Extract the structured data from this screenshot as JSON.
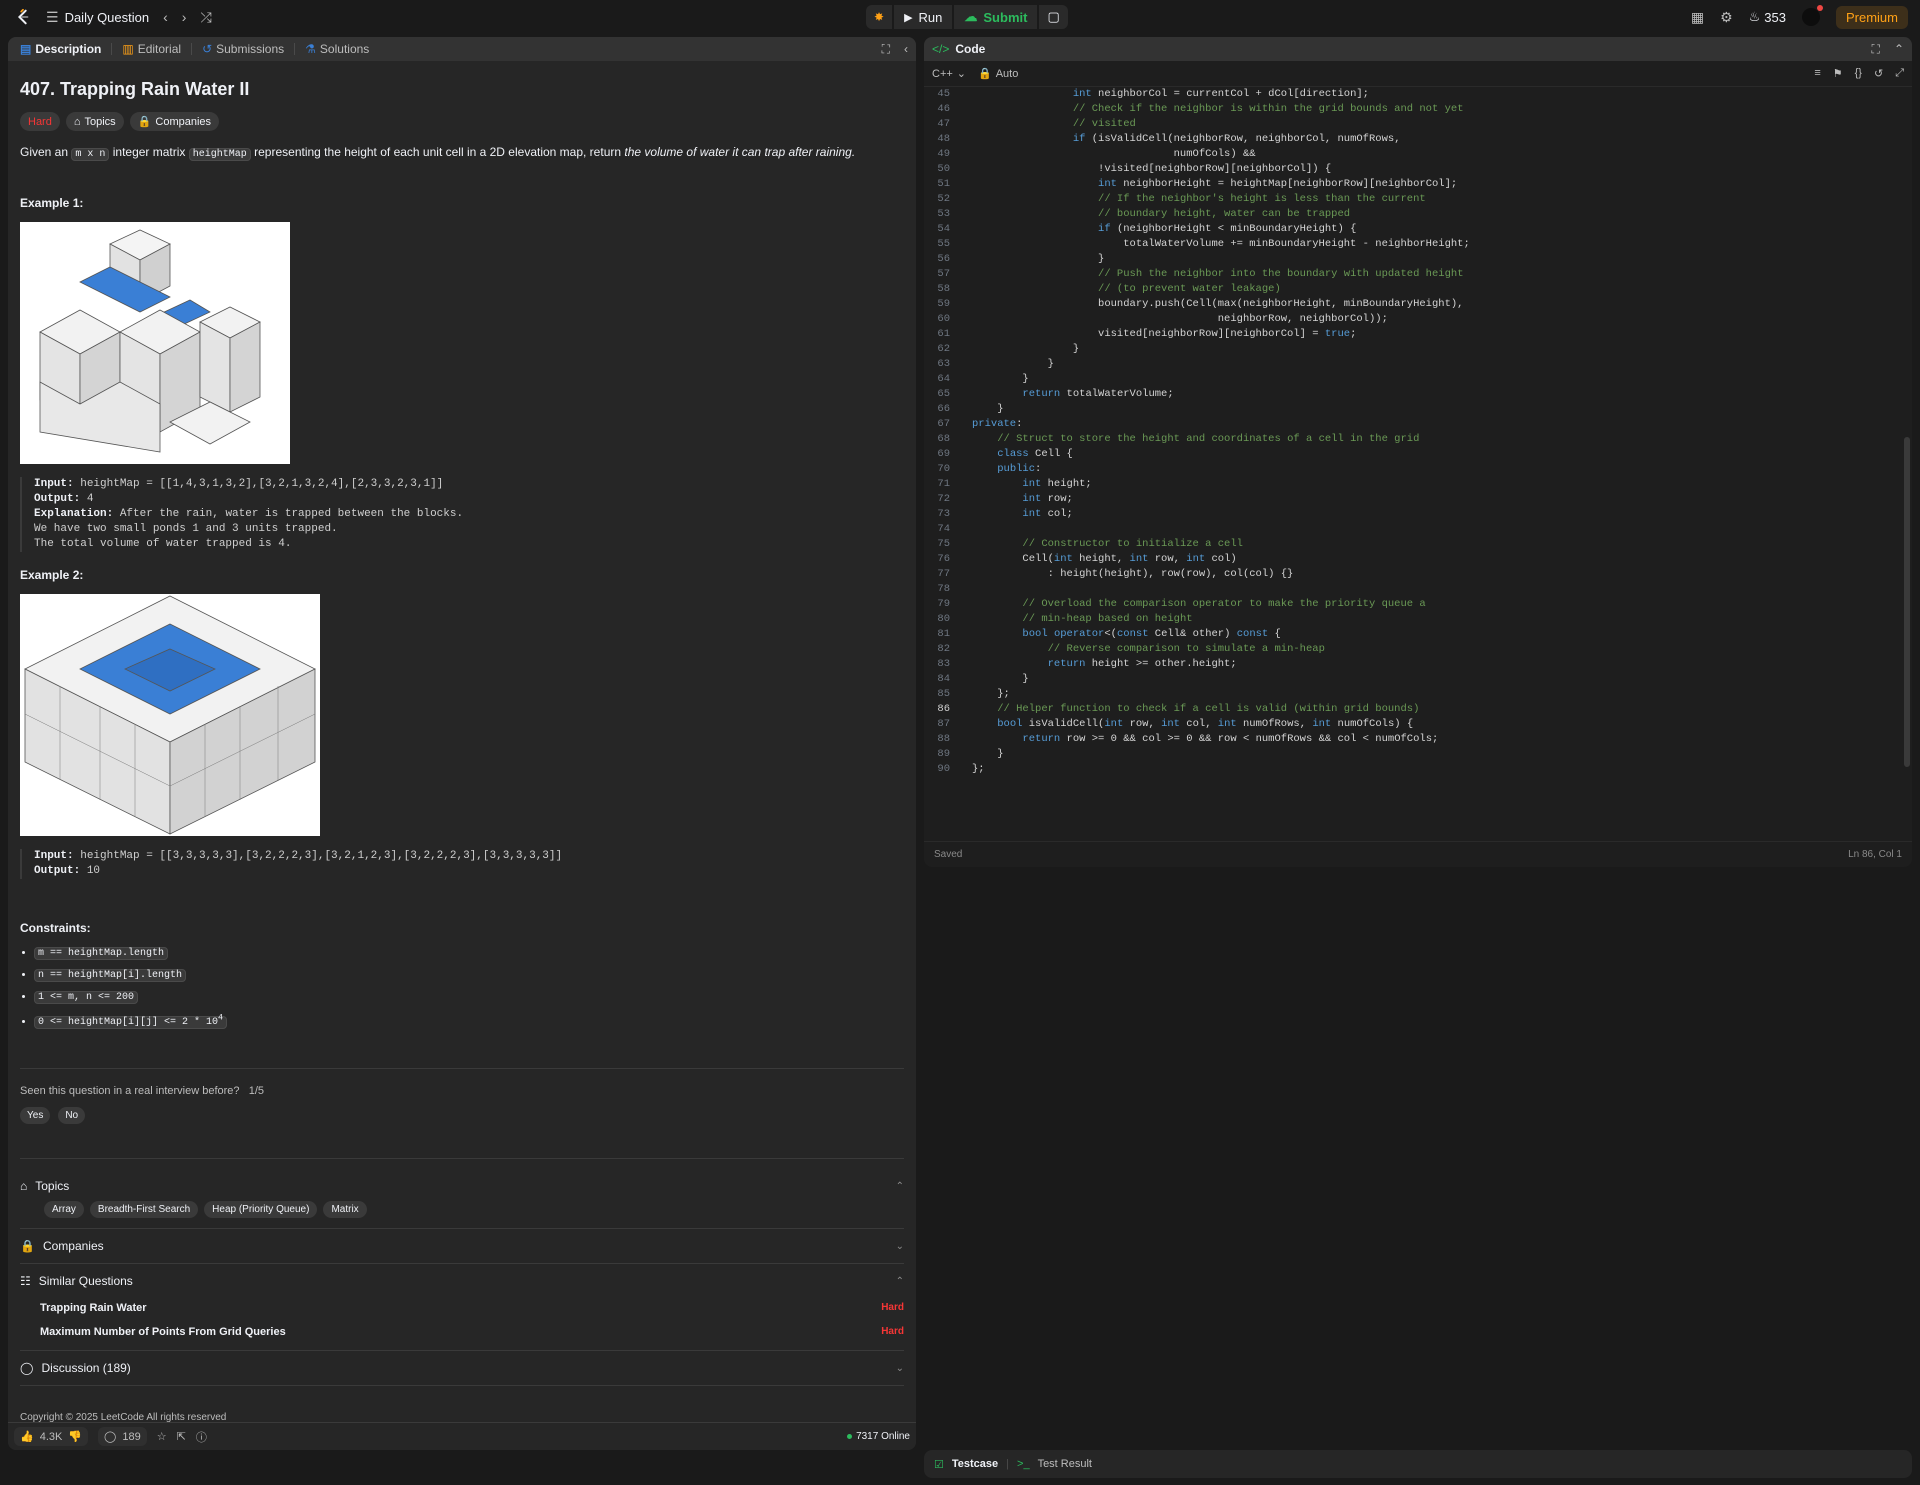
{
  "topbar": {
    "daily_question": "Daily Question",
    "run": "Run",
    "submit": "Submit",
    "streak": "353",
    "premium": "Premium"
  },
  "left_tabs": [
    "Description",
    "Editorial",
    "Submissions",
    "Solutions"
  ],
  "question": {
    "title": "407. Trapping Rain Water II",
    "difficulty": "Hard",
    "topics_label": "Topics",
    "companies_label": "Companies",
    "text_1": "Given an",
    "code_mn": "m x n",
    "text_2": "integer matrix",
    "code_hm": "heightMap",
    "text_3": "representing the height of each unit cell in a 2D elevation map, return",
    "text_em": "the volume of water it can trap after raining."
  },
  "examples": [
    {
      "title": "Example 1:",
      "input_label": "Input:",
      "input": "heightMap = [[1,4,3,1,3,2],[3,2,1,3,2,4],[2,3,3,2,3,1]]",
      "output_label": "Output:",
      "output": "4",
      "explanation_label": "Explanation:",
      "explanation_1": "After the rain, water is trapped between the blocks.",
      "explanation_2": "We have two small ponds 1 and 3 units trapped.",
      "explanation_3": "The total volume of water trapped is 4."
    },
    {
      "title": "Example 2:",
      "input_label": "Input:",
      "input": "heightMap = [[3,3,3,3,3],[3,2,2,2,3],[3,2,1,2,3],[3,2,2,2,3],[3,3,3,3,3]]",
      "output_label": "Output:",
      "output": "10"
    }
  ],
  "constraints_title": "Constraints:",
  "constraints": [
    "m == heightMap.length",
    "n == heightMap[i].length",
    "1 <= m, n <= 200",
    "0 <= heightMap[i][j] <= 2 * 10"
  ],
  "constraint_sup": "4",
  "seen": {
    "text": "Seen this question in a real interview before?",
    "count": "1/5",
    "yes": "Yes",
    "no": "No"
  },
  "accordion": {
    "topics": "Topics",
    "topic_tags": [
      "Array",
      "Breadth-First Search",
      "Heap (Priority Queue)",
      "Matrix"
    ],
    "companies": "Companies",
    "similar": "Similar Questions",
    "similar_items": [
      {
        "title": "Trapping Rain Water",
        "difficulty": "Hard"
      },
      {
        "title": "Maximum Number of Points From Grid Queries",
        "difficulty": "Hard"
      }
    ],
    "discussion": "Discussion (189)"
  },
  "copyright": "Copyright © 2025 LeetCode All rights reserved",
  "bottom": {
    "likes": "4.3K",
    "comments": "189",
    "online": "7317 Online"
  },
  "code": {
    "title": "Code",
    "language": "C++",
    "auto": "Auto",
    "status_saved": "Saved",
    "cursor": "Ln 86, Col 1",
    "current_line": 86,
    "lines": [
      {
        "n": 45,
        "t": "                int neighborCol = currentCol + dCol[direction];"
      },
      {
        "n": 46,
        "t": "                // Check if the neighbor is within the grid bounds and not yet"
      },
      {
        "n": 47,
        "t": "                // visited"
      },
      {
        "n": 48,
        "t": "                if (isValidCell(neighborRow, neighborCol, numOfRows,"
      },
      {
        "n": 49,
        "t": "                                numOfCols) &&"
      },
      {
        "n": 50,
        "t": "                    !visited[neighborRow][neighborCol]) {"
      },
      {
        "n": 51,
        "t": "                    int neighborHeight = heightMap[neighborRow][neighborCol];"
      },
      {
        "n": 52,
        "t": "                    // If the neighbor's height is less than the current"
      },
      {
        "n": 53,
        "t": "                    // boundary height, water can be trapped"
      },
      {
        "n": 54,
        "t": "                    if (neighborHeight < minBoundaryHeight) {"
      },
      {
        "n": 55,
        "t": "                        totalWaterVolume += minBoundaryHeight - neighborHeight;"
      },
      {
        "n": 56,
        "t": "                    }"
      },
      {
        "n": 57,
        "t": "                    // Push the neighbor into the boundary with updated height"
      },
      {
        "n": 58,
        "t": "                    // (to prevent water leakage)"
      },
      {
        "n": 59,
        "t": "                    boundary.push(Cell(max(neighborHeight, minBoundaryHeight),"
      },
      {
        "n": 60,
        "t": "                                       neighborRow, neighborCol));"
      },
      {
        "n": 61,
        "t": "                    visited[neighborRow][neighborCol] = true;"
      },
      {
        "n": 62,
        "t": "                }"
      },
      {
        "n": 63,
        "t": "            }"
      },
      {
        "n": 64,
        "t": "        }"
      },
      {
        "n": 65,
        "t": "        return totalWaterVolume;"
      },
      {
        "n": 66,
        "t": "    }"
      },
      {
        "n": 67,
        "t": "private:"
      },
      {
        "n": 68,
        "t": "    // Struct to store the height and coordinates of a cell in the grid"
      },
      {
        "n": 69,
        "t": "    class Cell {"
      },
      {
        "n": 70,
        "t": "    public:"
      },
      {
        "n": 71,
        "t": "        int height;"
      },
      {
        "n": 72,
        "t": "        int row;"
      },
      {
        "n": 73,
        "t": "        int col;"
      },
      {
        "n": 74,
        "t": ""
      },
      {
        "n": 75,
        "t": "        // Constructor to initialize a cell"
      },
      {
        "n": 76,
        "t": "        Cell(int height, int row, int col)"
      },
      {
        "n": 77,
        "t": "            : height(height), row(row), col(col) {}"
      },
      {
        "n": 78,
        "t": ""
      },
      {
        "n": 79,
        "t": "        // Overload the comparison operator to make the priority queue a"
      },
      {
        "n": 80,
        "t": "        // min-heap based on height"
      },
      {
        "n": 81,
        "t": "        bool operator<(const Cell& other) const {"
      },
      {
        "n": 82,
        "t": "            // Reverse comparison to simulate a min-heap"
      },
      {
        "n": 83,
        "t": "            return height >= other.height;"
      },
      {
        "n": 84,
        "t": "        }"
      },
      {
        "n": 85,
        "t": "    };"
      },
      {
        "n": 86,
        "t": "    // Helper function to check if a cell is valid (within grid bounds)"
      },
      {
        "n": 87,
        "t": "    bool isValidCell(int row, int col, int numOfRows, int numOfCols) {"
      },
      {
        "n": 88,
        "t": "        return row >= 0 && col >= 0 && row < numOfRows && col < numOfCols;"
      },
      {
        "n": 89,
        "t": "    }"
      },
      {
        "n": 90,
        "t": "};"
      }
    ]
  },
  "testcase": {
    "tab1": "Testcase",
    "tab2": "Test Result"
  },
  "colors": {
    "accent_green": "#2cbb5d",
    "hard_red": "#f63636",
    "premium_orange": "#ffa116",
    "water_blue": "#3a7fd5"
  }
}
